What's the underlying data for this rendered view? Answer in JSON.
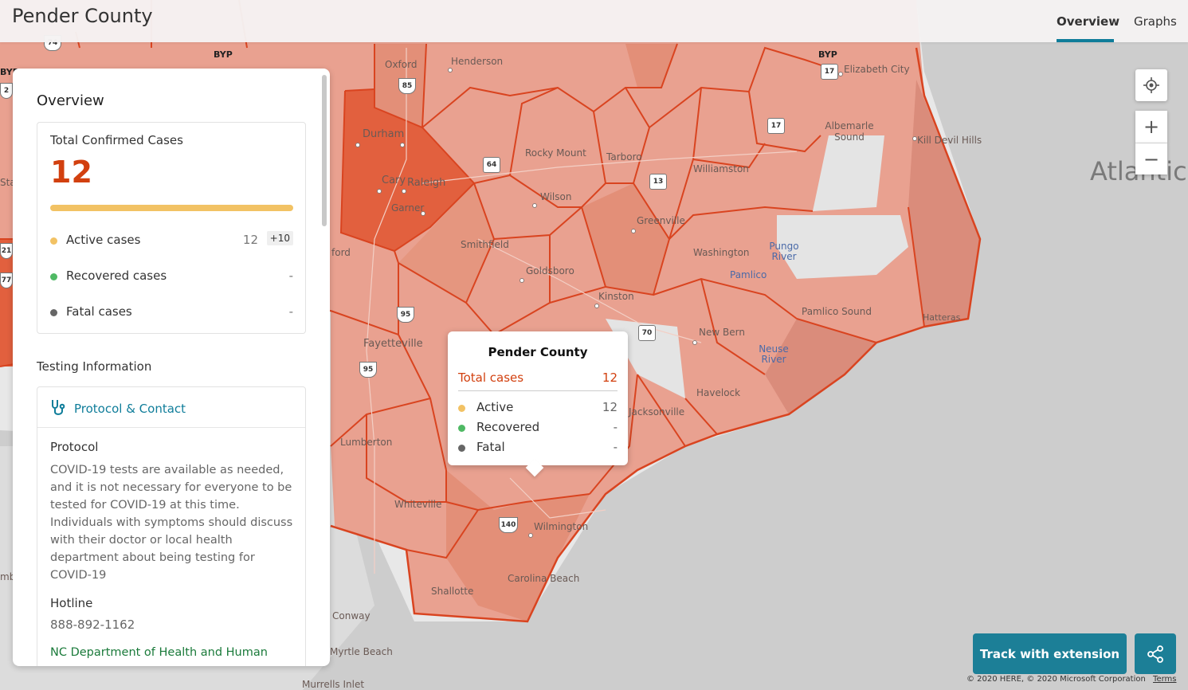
{
  "header": {
    "title": "Pender County",
    "tabs": [
      {
        "label": "Overview",
        "active": true
      },
      {
        "label": "Graphs",
        "active": false
      }
    ]
  },
  "map": {
    "cities": [
      "Oxford",
      "Henderson",
      "Durham",
      "Cary",
      "Raleigh",
      "Garner",
      "Rocky Mount",
      "Tarboro",
      "Williamston",
      "Wilson",
      "Greenville",
      "Smithfield",
      "Goldsboro",
      "Kinston",
      "Washington",
      "Fayetteville",
      "New Bern",
      "Havelock",
      "Jacksonville",
      "Lumberton",
      "Whiteville",
      "Wilmington",
      "Carolina Beach",
      "Shallotte",
      "Conway",
      "Myrtle Beach",
      "Murrells Inlet",
      "Elizabeth City",
      "Albemarle Sound",
      "Kill Devil Hills",
      "Pamlico Sound",
      "Hatteras",
      "ford",
      "Sta",
      "mb"
    ],
    "water_labels": [
      "Pungo River",
      "Pamlico",
      "Neuse River"
    ],
    "ocean_label": "Atlantic",
    "route_shields": [
      "85",
      "64",
      "13",
      "17",
      "95",
      "95",
      "70",
      "140",
      "17",
      "74",
      "21",
      "77",
      "2"
    ],
    "byp_labels": [
      "BYP",
      "BYP",
      "BYP"
    ],
    "county_fill": "#e9a190",
    "county_fill_dark": "#e2603e",
    "border_color": "#d94420"
  },
  "controls": {
    "locate_icon": "crosshair-icon",
    "zoom_in": "+",
    "zoom_out": "−"
  },
  "panel": {
    "title": "Overview",
    "summary": {
      "label": "Total Confirmed Cases",
      "total": "12",
      "active": {
        "label": "Active cases",
        "value": "12",
        "delta": "+10",
        "color": "#f2c264"
      },
      "recovered": {
        "label": "Recovered cases",
        "value": "-",
        "color": "#4fb964"
      },
      "fatal": {
        "label": "Fatal cases",
        "value": "-",
        "color": "#666666"
      }
    },
    "testing": {
      "heading": "Testing Information",
      "card_title": "Protocol & Contact",
      "protocol_heading": "Protocol",
      "protocol_text": "COVID-19 tests are available as needed, and it is not necessary for everyone to be tested for COVID-19 at this time. Individuals with symptoms should discuss with their doctor or local health department about being testing for COVID-19",
      "hotline_heading": "Hotline",
      "hotline": "888-892-1162",
      "link": "NC Department of Health and Human"
    }
  },
  "popup": {
    "title": "Pender County",
    "total_label": "Total cases",
    "total_value": "12",
    "rows": [
      {
        "label": "Active",
        "value": "12",
        "color": "#f2c264"
      },
      {
        "label": "Recovered",
        "value": "-",
        "color": "#4fb964"
      },
      {
        "label": "Fatal",
        "value": "-",
        "color": "#666666"
      }
    ]
  },
  "buttons": {
    "track": "Track with extension",
    "share_icon": "share-icon"
  },
  "footer": {
    "copyright": "© 2020 HERE, © 2020 Microsoft Corporation",
    "terms": "Terms"
  },
  "colors": {
    "accent": "#1c7f97",
    "cases": "#d2400f"
  }
}
